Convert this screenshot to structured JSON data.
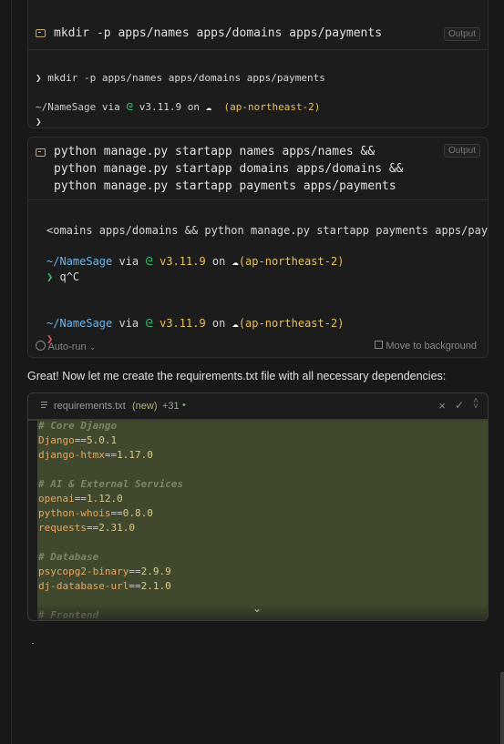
{
  "card1": {
    "command": "mkdir -p apps/names apps/domains apps/payments",
    "output_badge": "Output",
    "lines": {
      "l1_prompt": "❯",
      "l1_text": "mkdir -p apps/names apps/domains apps/payments",
      "path": "~/NameSage",
      "via": "via",
      "py_icon": "🐍",
      "pyver": "v3.11.9",
      "on": "on",
      "cloud": "☁",
      "region": "(ap-northeast-2)",
      "l4_prompt": "❯"
    }
  },
  "card2": {
    "command_lines": [
      "python manage.py startapp names apps/names &&",
      "python manage.py startapp domains apps/domains &&",
      "python manage.py startapp payments apps/payments"
    ],
    "output_badge": "Output",
    "term": {
      "l1": "<omains apps/domains && python manage.py startapp payments apps/paymen",
      "path": "~/NameSage",
      "via": "via",
      "pyver": "v3.11.9",
      "on": "on",
      "region": "(ap-northeast-2)",
      "prompt_green": "❯",
      "typed": "q^C",
      "prompt_red": "❯"
    },
    "auto_run": "Auto-run",
    "move_bg": "Move to background"
  },
  "message": "Great! Now let me create the requirements.txt file with all necessary dependencies:",
  "editor": {
    "filename": "requirements.txt",
    "new_tag": "(new)",
    "added": "+31",
    "dot": "•",
    "lines": [
      {
        "kind": "comment",
        "text": "# Core Django"
      },
      {
        "kind": "req",
        "pkg": "Django",
        "op": "==",
        "ver": "5.0.1"
      },
      {
        "kind": "req",
        "pkg": "django-htmx",
        "op": "==",
        "ver": "1.17.0"
      },
      {
        "kind": "blank",
        "text": ""
      },
      {
        "kind": "comment",
        "text": "# AI & External Services"
      },
      {
        "kind": "req",
        "pkg": "openai",
        "op": "==",
        "ver": "1.12.0"
      },
      {
        "kind": "req",
        "pkg": "python-whois",
        "op": "==",
        "ver": "0.8.0"
      },
      {
        "kind": "req",
        "pkg": "requests",
        "op": "==",
        "ver": "2.31.0"
      },
      {
        "kind": "blank",
        "text": ""
      },
      {
        "kind": "comment",
        "text": "# Database"
      },
      {
        "kind": "req",
        "pkg": "psycopg2-binary",
        "op": "==",
        "ver": "2.9.9"
      },
      {
        "kind": "req",
        "pkg": "dj-database-url",
        "op": "==",
        "ver": "2.1.0"
      },
      {
        "kind": "blank",
        "text": ""
      },
      {
        "kind": "comment",
        "text": "# Frontend"
      }
    ]
  }
}
